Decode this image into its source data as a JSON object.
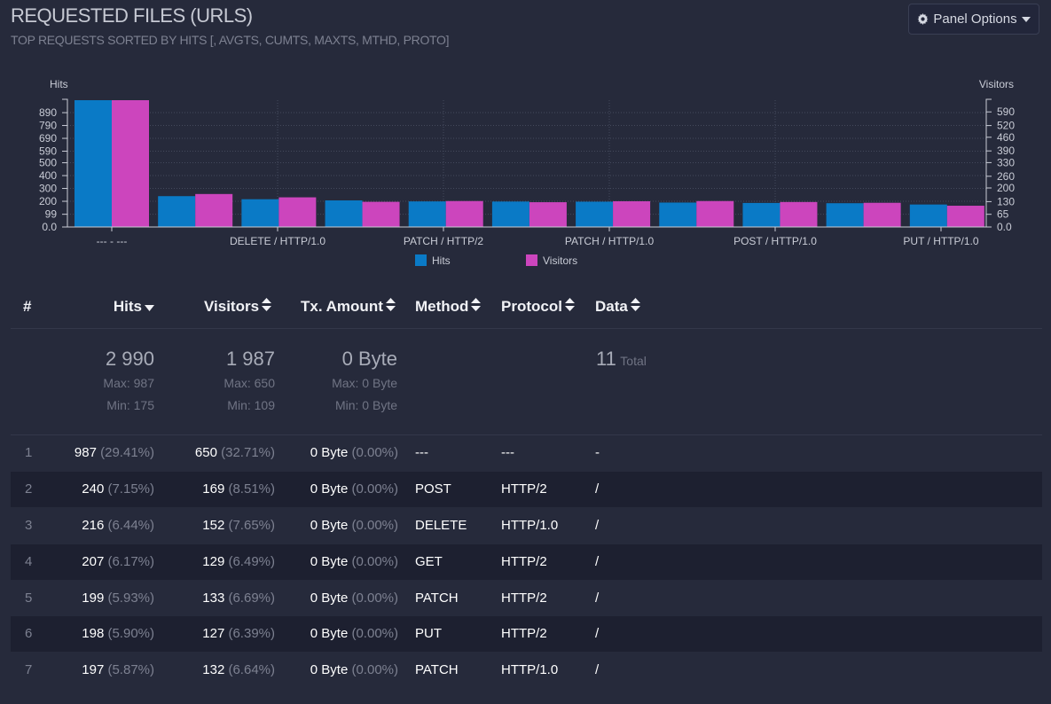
{
  "header": {
    "title": "REQUESTED FILES (URLS)",
    "subtitle": "TOP REQUESTS SORTED BY HITS [, AVGTS, CUMTS, MAXTS, MTHD, PROTO]",
    "panel_options_label": "Panel Options",
    "panel_options_icon": "gear-icon",
    "panel_options_caret": "caret-down-icon"
  },
  "colors": {
    "hits": "#0a7ac6",
    "visitors": "#cc45bd",
    "background": "#262a3b"
  },
  "chart_data": {
    "type": "bar",
    "categories": [
      "--- - ---",
      "",
      "DELETE / HTTP/1.0",
      "",
      "PATCH / HTTP/2",
      "",
      "PATCH / HTTP/1.0",
      "",
      "POST / HTTP/1.0",
      "",
      "PUT / HTTP/1.0"
    ],
    "series": [
      {
        "name": "Hits",
        "axis": "left",
        "values": [
          987,
          240,
          216,
          207,
          199,
          198,
          197,
          190,
          187,
          185,
          175
        ]
      },
      {
        "name": "Visitors",
        "axis": "right",
        "values": [
          650,
          169,
          152,
          129,
          133,
          127,
          132,
          133,
          128,
          124,
          109
        ]
      }
    ],
    "ylabel_left": "Hits",
    "ylabel_right": "Visitors",
    "yticks_left": [
      "0.0",
      "99",
      "200",
      "300",
      "400",
      "500",
      "590",
      "690",
      "790",
      "890"
    ],
    "yticks_right": [
      "0.0",
      "65",
      "130",
      "200",
      "260",
      "330",
      "390",
      "460",
      "520",
      "590"
    ],
    "ylim_left": [
      0,
      987
    ],
    "ylim_right": [
      0,
      650
    ],
    "grid": true,
    "legend": [
      "Hits",
      "Visitors"
    ],
    "legend_position": "bottom-center"
  },
  "table": {
    "columns": [
      {
        "label": "#",
        "sort_icon": ""
      },
      {
        "label": "Hits",
        "sort_icon": "caret-down-icon"
      },
      {
        "label": "Visitors",
        "sort_icon": "sort-icon"
      },
      {
        "label": "Tx. Amount",
        "sort_icon": "sort-icon"
      },
      {
        "label": "Method",
        "sort_icon": "sort-icon"
      },
      {
        "label": "Protocol",
        "sort_icon": "sort-icon"
      },
      {
        "label": "Data",
        "sort_icon": "sort-icon"
      }
    ],
    "summary": {
      "hits_total": "2 990",
      "hits_max": "Max: 987",
      "hits_min": "Min: 175",
      "visitors_total": "1 987",
      "visitors_max": "Max: 650",
      "visitors_min": "Min: 109",
      "tx_total": "0 Byte",
      "tx_max": "Max: 0 Byte",
      "tx_min": "Min: 0 Byte",
      "data_total": "11",
      "data_total_label": "Total"
    },
    "rows": [
      {
        "n": "1",
        "hits": "987",
        "hits_pct": "(29.41%)",
        "visitors": "650",
        "visitors_pct": "(32.71%)",
        "tx": "0 Byte",
        "tx_pct": "(0.00%)",
        "method": "---",
        "protocol": "---",
        "data": "-"
      },
      {
        "n": "2",
        "hits": "240",
        "hits_pct": "(7.15%)",
        "visitors": "169",
        "visitors_pct": "(8.51%)",
        "tx": "0 Byte",
        "tx_pct": "(0.00%)",
        "method": "POST",
        "protocol": "HTTP/2",
        "data": "/"
      },
      {
        "n": "3",
        "hits": "216",
        "hits_pct": "(6.44%)",
        "visitors": "152",
        "visitors_pct": "(7.65%)",
        "tx": "0 Byte",
        "tx_pct": "(0.00%)",
        "method": "DELETE",
        "protocol": "HTTP/1.0",
        "data": "/"
      },
      {
        "n": "4",
        "hits": "207",
        "hits_pct": "(6.17%)",
        "visitors": "129",
        "visitors_pct": "(6.49%)",
        "tx": "0 Byte",
        "tx_pct": "(0.00%)",
        "method": "GET",
        "protocol": "HTTP/2",
        "data": "/"
      },
      {
        "n": "5",
        "hits": "199",
        "hits_pct": "(5.93%)",
        "visitors": "133",
        "visitors_pct": "(6.69%)",
        "tx": "0 Byte",
        "tx_pct": "(0.00%)",
        "method": "PATCH",
        "protocol": "HTTP/2",
        "data": "/"
      },
      {
        "n": "6",
        "hits": "198",
        "hits_pct": "(5.90%)",
        "visitors": "127",
        "visitors_pct": "(6.39%)",
        "tx": "0 Byte",
        "tx_pct": "(0.00%)",
        "method": "PUT",
        "protocol": "HTTP/2",
        "data": "/"
      },
      {
        "n": "7",
        "hits": "197",
        "hits_pct": "(5.87%)",
        "visitors": "132",
        "visitors_pct": "(6.64%)",
        "tx": "0 Byte",
        "tx_pct": "(0.00%)",
        "method": "PATCH",
        "protocol": "HTTP/1.0",
        "data": "/"
      }
    ]
  }
}
